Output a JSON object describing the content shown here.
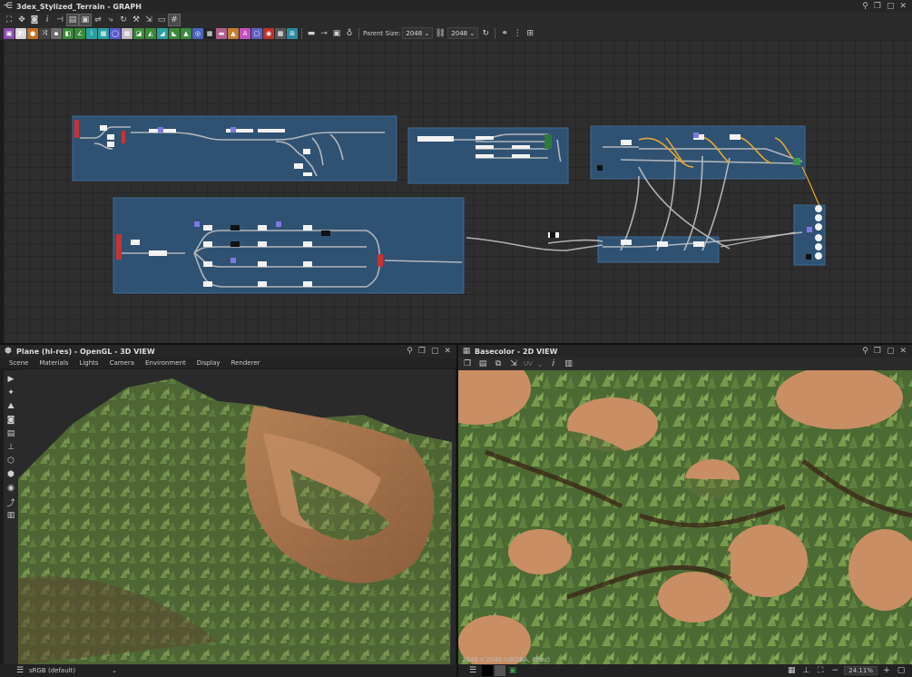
{
  "graph_panel": {
    "title": "3dex_Stylized_Terrain - GRAPH",
    "parent_size_label": "Parent Size:",
    "parent_size_value": "2048",
    "size_value": "2048",
    "toolbar_icons": [
      "fit-view-icon",
      "pan-icon",
      "screenshot-icon",
      "info-icon",
      "align-icon",
      "layout-icon",
      "frame-icon",
      "link-icon",
      "branch-icon",
      "refresh-icon",
      "tool-icon",
      "export-icon",
      "comment-icon",
      "grid-icon"
    ],
    "node_icons": [
      {
        "name": "bitmap-node-icon",
        "color": "#8a4fb0",
        "glyph": "▣"
      },
      {
        "name": "svg-node-icon",
        "color": "#d8d8d8",
        "glyph": "◩"
      },
      {
        "name": "color-node-icon",
        "color": "#c07020",
        "glyph": "●"
      },
      {
        "name": "blend-node-icon",
        "color": "#444444",
        "glyph": "⤨"
      },
      {
        "name": "levels-node-icon",
        "color": "#6c6c6c",
        "glyph": "▪"
      },
      {
        "name": "gradient-node-icon",
        "color": "#3a8a3a",
        "glyph": "◧"
      },
      {
        "name": "curve-node-icon",
        "color": "#3a8a3a",
        "glyph": "∠"
      },
      {
        "name": "warp-node-icon",
        "color": "#2aa0a0",
        "glyph": "⌇"
      },
      {
        "name": "noise-node-icon",
        "color": "#2aa0a0",
        "glyph": "▦"
      },
      {
        "name": "blur-node-icon",
        "color": "#5a5ad0",
        "glyph": "◯"
      },
      {
        "name": "pattern-node-icon",
        "color": "#bbbbbb",
        "glyph": "▦"
      },
      {
        "name": "tile-node-icon",
        "color": "#3a8a3a",
        "glyph": "◪"
      },
      {
        "name": "normal-node-icon",
        "color": "#3a8a3a",
        "glyph": "◭"
      },
      {
        "name": "height-node-icon",
        "color": "#2aa0a0",
        "glyph": "◢"
      },
      {
        "name": "mask-node-icon",
        "color": "#3a8a3a",
        "glyph": "◣"
      },
      {
        "name": "transform-node-icon",
        "color": "#3a8a3a",
        "glyph": "▲"
      },
      {
        "name": "histogram-node-icon",
        "color": "#4a64c0",
        "glyph": "◎"
      },
      {
        "name": "fx-node-icon",
        "color": "#222222",
        "glyph": "▦"
      },
      {
        "name": "uniform-node-icon",
        "color": "#b06090",
        "glyph": "▬"
      },
      {
        "name": "triangle-node-icon",
        "color": "#c08030",
        "glyph": "▲"
      },
      {
        "name": "text-node-icon",
        "color": "#c050c0",
        "glyph": "A"
      },
      {
        "name": "frame-node-icon",
        "color": "#6060c0",
        "glyph": "▢"
      },
      {
        "name": "output-node-icon",
        "color": "#c03030",
        "glyph": "◉"
      },
      {
        "name": "pixel-node-icon",
        "color": "#555555",
        "glyph": "▦"
      },
      {
        "name": "fxmap-node-icon",
        "color": "#2a8aa0",
        "glyph": "⊞"
      }
    ]
  },
  "view3d": {
    "title": "Plane (hi-res) - OpenGL - 3D VIEW",
    "menu": [
      "Scene",
      "Materials",
      "Lights",
      "Camera",
      "Environment",
      "Display",
      "Renderer"
    ],
    "tools": [
      "camera-icon",
      "light-icon",
      "environment-icon",
      "screenshot-icon",
      "layout-icon",
      "axis-icon",
      "cube-icon",
      "mesh-icon",
      "eye-icon",
      "curve-icon",
      "histogram-icon"
    ],
    "colorspace": "sRGB (default)"
  },
  "view2d": {
    "title": "Basecolor - 2D VIEW",
    "channel_label": "UV",
    "info": "2048 x 2048 (sRGBA, 8bpc)",
    "zoom": "24.11%"
  },
  "colors": {
    "frame": "#2f5273",
    "terrain_dirt": "#c98e63",
    "foliage": "#5e7b3d"
  }
}
